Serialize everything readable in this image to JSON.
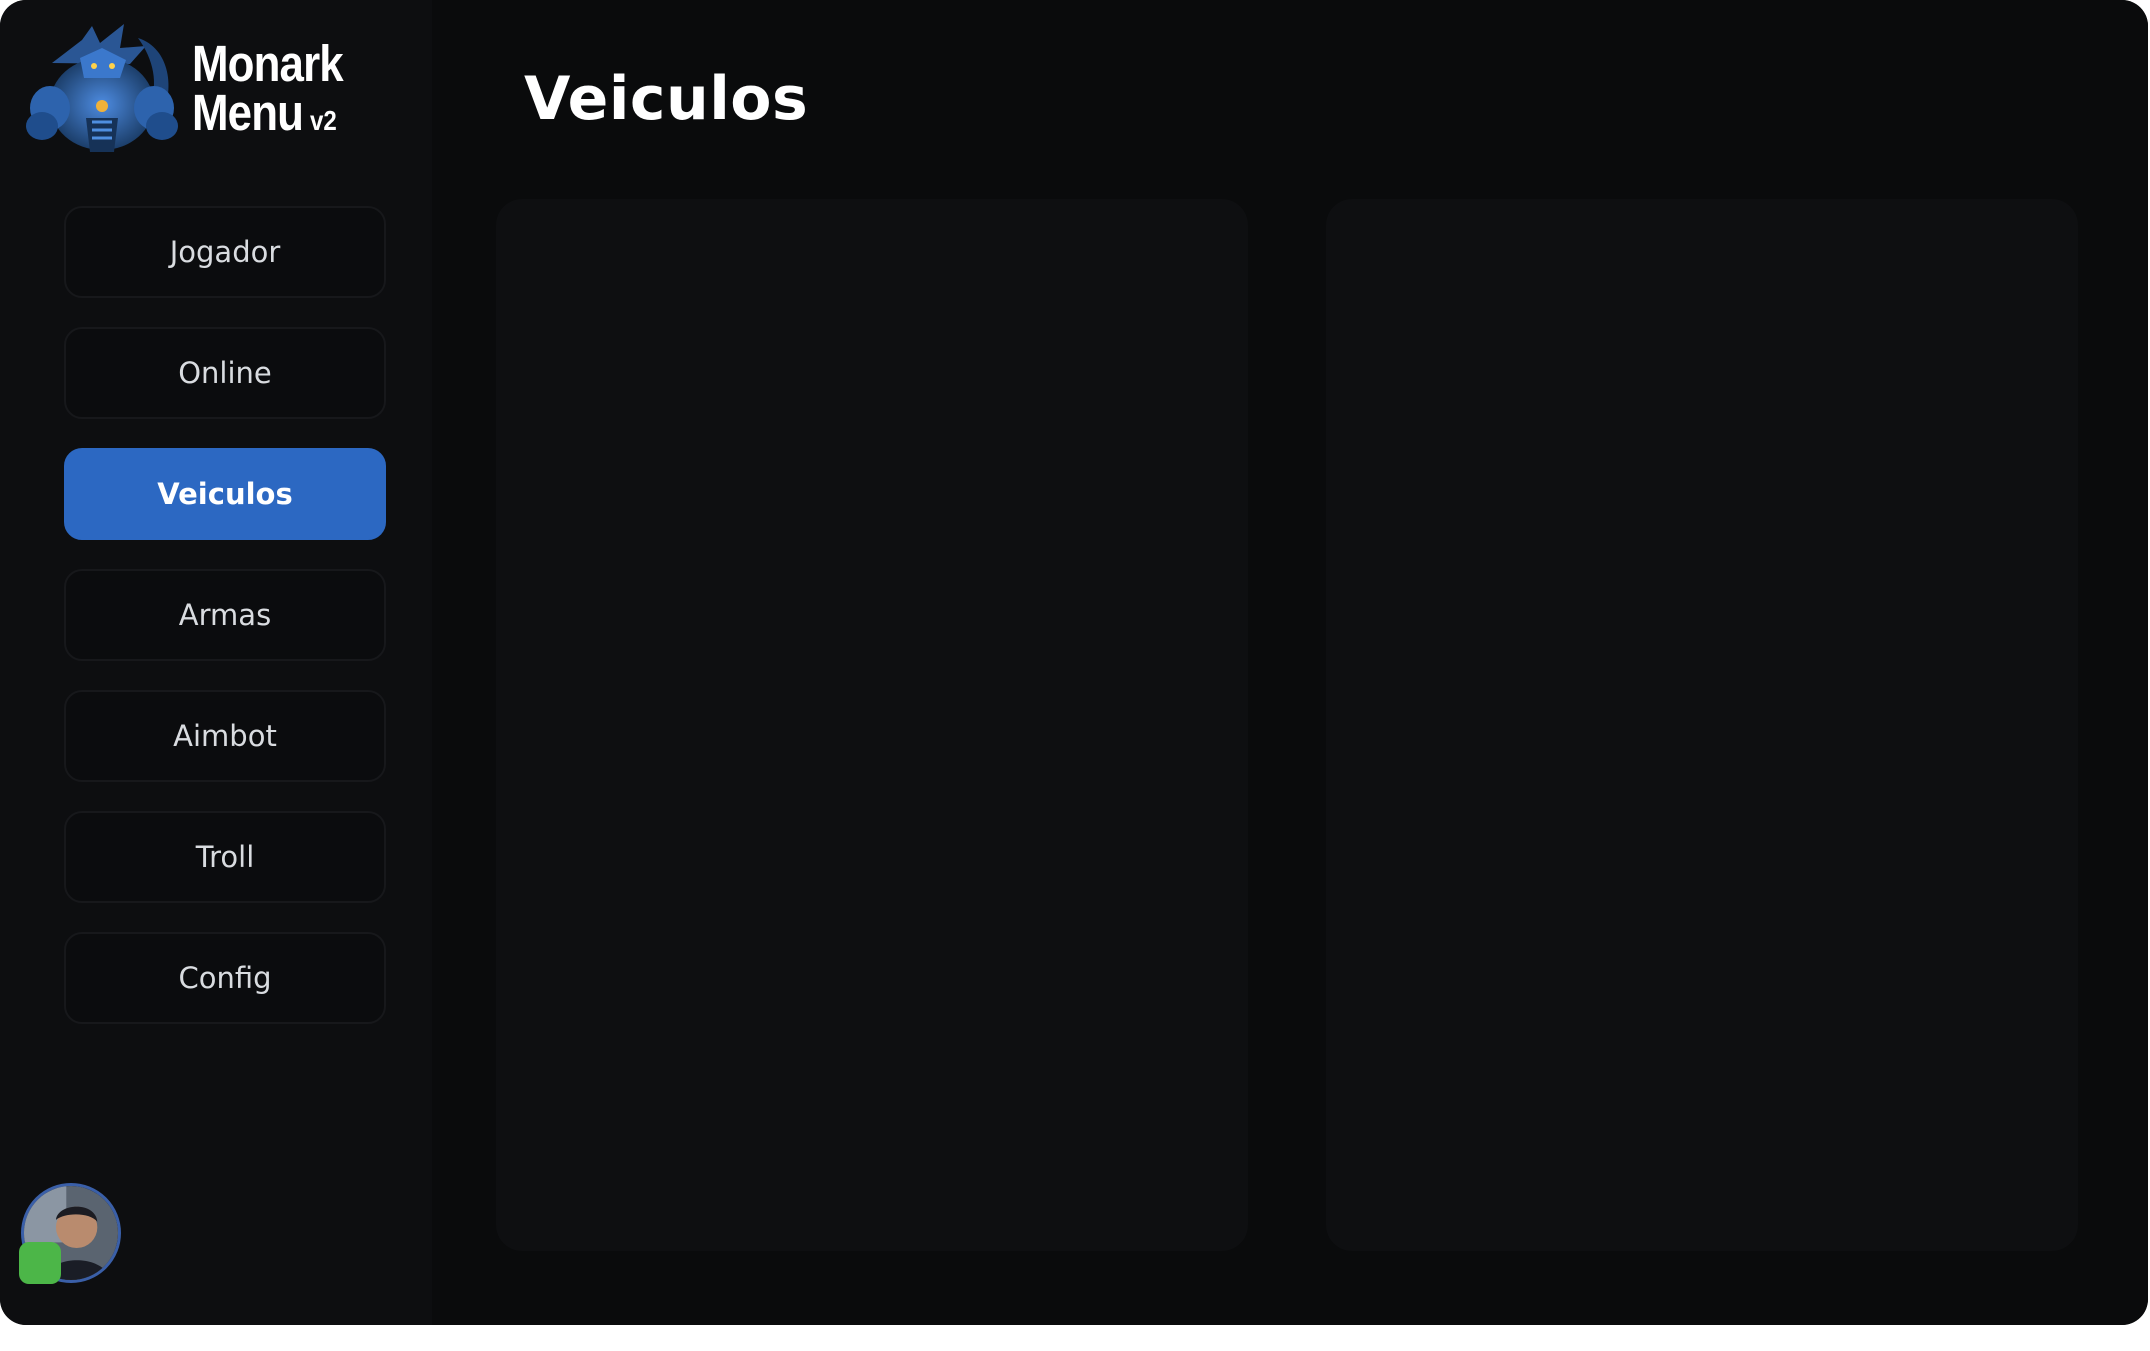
{
  "brand": {
    "line1": "Monark",
    "line2": "Menu",
    "version": "v2",
    "logo_icon": "dragon-logo-icon"
  },
  "sidebar": {
    "items": [
      {
        "label": "Jogador",
        "active": false
      },
      {
        "label": "Online",
        "active": false
      },
      {
        "label": "Veiculos",
        "active": true
      },
      {
        "label": "Armas",
        "active": false
      },
      {
        "label": "Aimbot",
        "active": false
      },
      {
        "label": "Troll",
        "active": false
      },
      {
        "label": "Config",
        "active": false
      }
    ]
  },
  "user": {
    "avatar_icon": "user-avatar-icon",
    "status": "online",
    "status_color": "#4cb648"
  },
  "main": {
    "title": "Veiculos"
  },
  "colors": {
    "accent": "#2c68c2",
    "background": "#0a0b0c",
    "sidebar": "#0d0e10",
    "panel": "#0e0f11"
  }
}
